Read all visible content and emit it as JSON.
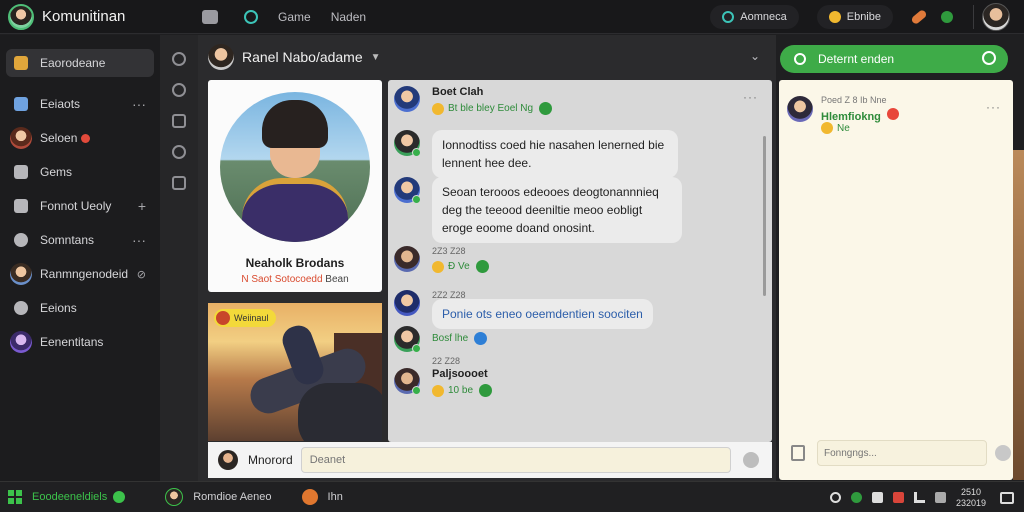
{
  "topbar": {
    "app_title": "Komunitinan",
    "links": [
      "Game",
      "Naden"
    ],
    "status_pill": "Aomneca",
    "coins_pill": "Ebnibe",
    "colors": {
      "accent": "#3eab48",
      "bg": "#18181a"
    }
  },
  "sidebar": {
    "items": [
      {
        "label": "Eaorodeane",
        "icon": "home-icon",
        "active": true
      },
      {
        "label": "Eeiaots",
        "icon": "chat-icon",
        "trail": "···"
      },
      {
        "label": "Seloen",
        "icon": "avatar",
        "badge": true
      },
      {
        "label": "Gems",
        "icon": "grid-icon"
      },
      {
        "label": "Fonnot Ueoly",
        "icon": "controller-icon",
        "trail": "+"
      },
      {
        "label": "Somntans",
        "icon": "circle-icon",
        "trail": "···"
      },
      {
        "label": "Ranmngenodeid",
        "icon": "avatar",
        "trail": "⊘"
      },
      {
        "label": "Eeions",
        "icon": "globe-icon"
      },
      {
        "label": "Eenentitans",
        "icon": "avatar"
      }
    ]
  },
  "chat": {
    "header_title": "Ranel Nabo/adame",
    "profile": {
      "name": "Neaholk Brodans",
      "sub_red": "N Saot Sotocoedd",
      "sub_dark": "Bean"
    },
    "game_badge": "Weiinaul",
    "messages": [
      {
        "name": "Boet Clah",
        "reaction": "Bt ble bley Eoel Ng",
        "dots": "···"
      },
      {
        "text": "Ionnodtiss coed hie nasahen lenerned bie lennent hee dee."
      },
      {
        "text": "Seoan terooos edeooes deogtonannnieq deg the teeood deeniltie meoo eobligt eroge eoome doand onosint."
      },
      {
        "time": "2Z3 Z28",
        "reaction": "Ð Ve"
      },
      {
        "time": "2Z2 Z28"
      },
      {
        "text": "Ponie ots eneo oeemdentien soociten"
      },
      {
        "name": "Bosf lhe"
      },
      {
        "time": "22 Z28"
      },
      {
        "name": "Paljsoooet",
        "reaction": "10 be"
      }
    ],
    "composer": {
      "label": "Mnorord",
      "placeholder": "Deanet"
    }
  },
  "right_panel": {
    "header": "Deternt enden",
    "time": "Poed Z 8 Ib Nne",
    "name": "Hlemfiokng",
    "sub": "Ne",
    "input_placeholder": "Fonngngs..."
  },
  "taskbar": {
    "start_label": "Eoodeeneldiels",
    "app1": "Romdioe Aeneo",
    "app2": "Ihn",
    "clock_time": "2510",
    "clock_date": "232019"
  }
}
